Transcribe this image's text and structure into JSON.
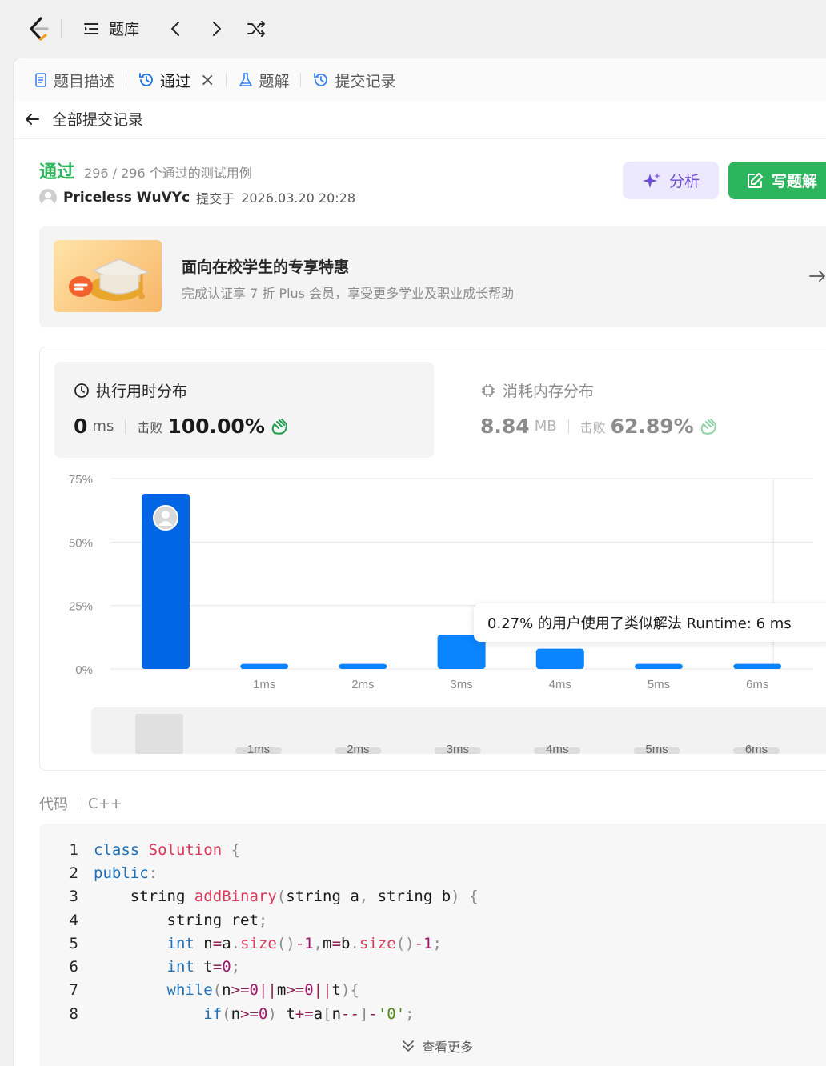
{
  "nav": {
    "library_label": "题库"
  },
  "tabs": [
    {
      "label": "题目描述",
      "icon": "doc-icon"
    },
    {
      "label": "通过",
      "icon": "history-icon"
    },
    {
      "label": "题解",
      "icon": "flask-icon"
    },
    {
      "label": "提交记录",
      "icon": "history-icon"
    }
  ],
  "back_label": "全部提交记录",
  "submission": {
    "status": "通过",
    "cases": "296 / 296 个通过的测试用例",
    "user": "Priceless WuVYc",
    "submitted_prefix": "提交于",
    "submitted_at": "2026.03.20 20:28"
  },
  "actions": {
    "analyze": "分析",
    "write": "写题解"
  },
  "promo": {
    "title": "面向在校学生的专享特惠",
    "subtitle": "完成认证享 7 折 Plus 会员，享受更多学业及职业成长帮助"
  },
  "runtime": {
    "title": "执行用时分布",
    "value": "0",
    "unit": "ms",
    "beat_label": "击败",
    "beat": "100.00%"
  },
  "memory": {
    "title": "消耗内存分布",
    "value": "8.84",
    "unit": "MB",
    "beat_label": "击败",
    "beat": "62.89%"
  },
  "tooltip": "0.27% 的用户使用了类似解法 Runtime: 6 ms",
  "chart_data": {
    "type": "bar",
    "y_ticks": [
      "75%",
      "50%",
      "25%",
      "0%"
    ],
    "ylim": [
      0,
      75
    ],
    "categories": [
      "0ms",
      "1ms",
      "2ms",
      "3ms",
      "4ms",
      "5ms",
      "6ms"
    ],
    "x_tick_labels": [
      "",
      "1ms",
      "2ms",
      "3ms",
      "4ms",
      "5ms",
      "6ms"
    ],
    "values": [
      69,
      2,
      2,
      13.5,
      8,
      2,
      2
    ],
    "highlight_index": 0,
    "colors": {
      "selected": "#0066e6",
      "bar": "#0a84ff",
      "grid": "#e6e6e6",
      "mini_bar": "#e0e0e0"
    },
    "mini_labels": [
      "1ms",
      "2ms",
      "3ms",
      "4ms",
      "5ms",
      "6ms"
    ]
  },
  "code": {
    "header": "代码",
    "lang": "C++",
    "more": "查看更多",
    "lines": [
      [
        [
          "kw",
          "class"
        ],
        [
          "plain",
          " "
        ],
        [
          "cls",
          "Solution"
        ],
        [
          "plain",
          " "
        ],
        [
          "pu",
          "{"
        ]
      ],
      [
        [
          "kw",
          "public"
        ],
        [
          "pu",
          ":"
        ]
      ],
      [
        [
          "plain",
          "    string "
        ],
        [
          "fn",
          "addBinary"
        ],
        [
          "pu",
          "("
        ],
        [
          "plain",
          "string a"
        ],
        [
          "pu",
          ","
        ],
        [
          "plain",
          " string b"
        ],
        [
          "pu",
          ")"
        ],
        [
          "plain",
          " "
        ],
        [
          "pu",
          "{"
        ]
      ],
      [
        [
          "plain",
          "        string ret"
        ],
        [
          "pu",
          ";"
        ]
      ],
      [
        [
          "plain",
          "        "
        ],
        [
          "kw",
          "int"
        ],
        [
          "plain",
          " n"
        ],
        [
          "op",
          "="
        ],
        [
          "plain",
          "a"
        ],
        [
          "pu",
          "."
        ],
        [
          "fn",
          "size"
        ],
        [
          "pu",
          "()"
        ],
        [
          "op",
          "-"
        ],
        [
          "num",
          "1"
        ],
        [
          "pu",
          ","
        ],
        [
          "plain",
          "m"
        ],
        [
          "op",
          "="
        ],
        [
          "plain",
          "b"
        ],
        [
          "pu",
          "."
        ],
        [
          "fn",
          "size"
        ],
        [
          "pu",
          "()"
        ],
        [
          "op",
          "-"
        ],
        [
          "num",
          "1"
        ],
        [
          "pu",
          ";"
        ]
      ],
      [
        [
          "plain",
          "        "
        ],
        [
          "kw",
          "int"
        ],
        [
          "plain",
          " t"
        ],
        [
          "op",
          "="
        ],
        [
          "num",
          "0"
        ],
        [
          "pu",
          ";"
        ]
      ],
      [
        [
          "plain",
          "        "
        ],
        [
          "kw",
          "while"
        ],
        [
          "pu",
          "("
        ],
        [
          "plain",
          "n"
        ],
        [
          "op",
          ">="
        ],
        [
          "num",
          "0"
        ],
        [
          "op",
          "||"
        ],
        [
          "plain",
          "m"
        ],
        [
          "op",
          ">="
        ],
        [
          "num",
          "0"
        ],
        [
          "op",
          "||"
        ],
        [
          "plain",
          "t"
        ],
        [
          "pu",
          "){"
        ]
      ],
      [
        [
          "plain",
          "            "
        ],
        [
          "kw",
          "if"
        ],
        [
          "pu",
          "("
        ],
        [
          "plain",
          "n"
        ],
        [
          "op",
          ">="
        ],
        [
          "num",
          "0"
        ],
        [
          "pu",
          ")"
        ],
        [
          "plain",
          " t"
        ],
        [
          "op",
          "+="
        ],
        [
          "plain",
          "a"
        ],
        [
          "pu",
          "["
        ],
        [
          "plain",
          "n"
        ],
        [
          "op",
          "--"
        ],
        [
          "pu",
          "]"
        ],
        [
          "op",
          "-"
        ],
        [
          "str",
          "'0'"
        ],
        [
          "pu",
          ";"
        ]
      ]
    ]
  }
}
